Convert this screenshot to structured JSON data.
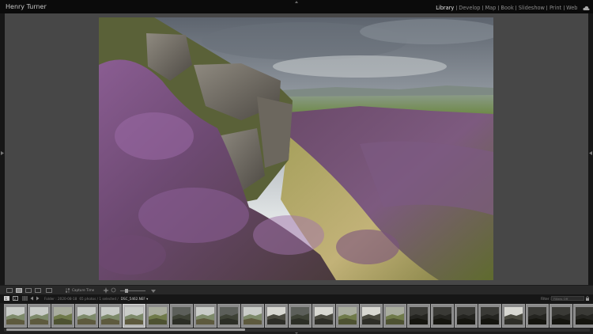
{
  "identity": {
    "name": "Henry Turner"
  },
  "modules": [
    {
      "label": "Library",
      "active": true
    },
    {
      "label": "Develop",
      "active": false
    },
    {
      "label": "Map",
      "active": false
    },
    {
      "label": "Book",
      "active": false
    },
    {
      "label": "Slideshow",
      "active": false
    },
    {
      "label": "Print",
      "active": false
    },
    {
      "label": "Web",
      "active": false
    }
  ],
  "toolbar": {
    "sort_label": "Capture Time"
  },
  "filmstrip": {
    "folder_label": "Folder : 2020-08-18",
    "photo_count": "65 photos / 1 selected /",
    "file_name": "DSC_5462.NEF ▾",
    "filter_label": "Filter :",
    "filter_value": "Filters Off",
    "selected_index": 5,
    "thumbnails": [
      {
        "tone": "sky"
      },
      {
        "tone": "sky"
      },
      {
        "tone": "field"
      },
      {
        "tone": "sky"
      },
      {
        "tone": "sky"
      },
      {
        "tone": "sky"
      },
      {
        "tone": "field"
      },
      {
        "tone": "dark"
      },
      {
        "tone": "sky"
      },
      {
        "tone": "dark"
      },
      {
        "tone": "sky"
      },
      {
        "tone": "rock"
      },
      {
        "tone": "dark"
      },
      {
        "tone": "rock"
      },
      {
        "tone": "field"
      },
      {
        "tone": "rock"
      },
      {
        "tone": "field"
      },
      {
        "tone": "night"
      },
      {
        "tone": "night"
      },
      {
        "tone": "night"
      },
      {
        "tone": "night"
      },
      {
        "tone": "rock"
      },
      {
        "tone": "night"
      },
      {
        "tone": "night"
      },
      {
        "tone": "night"
      }
    ]
  },
  "colors": {
    "accent": "#e8e8e8",
    "panel": "#474747",
    "selected_cell": "#b4b4b4"
  }
}
